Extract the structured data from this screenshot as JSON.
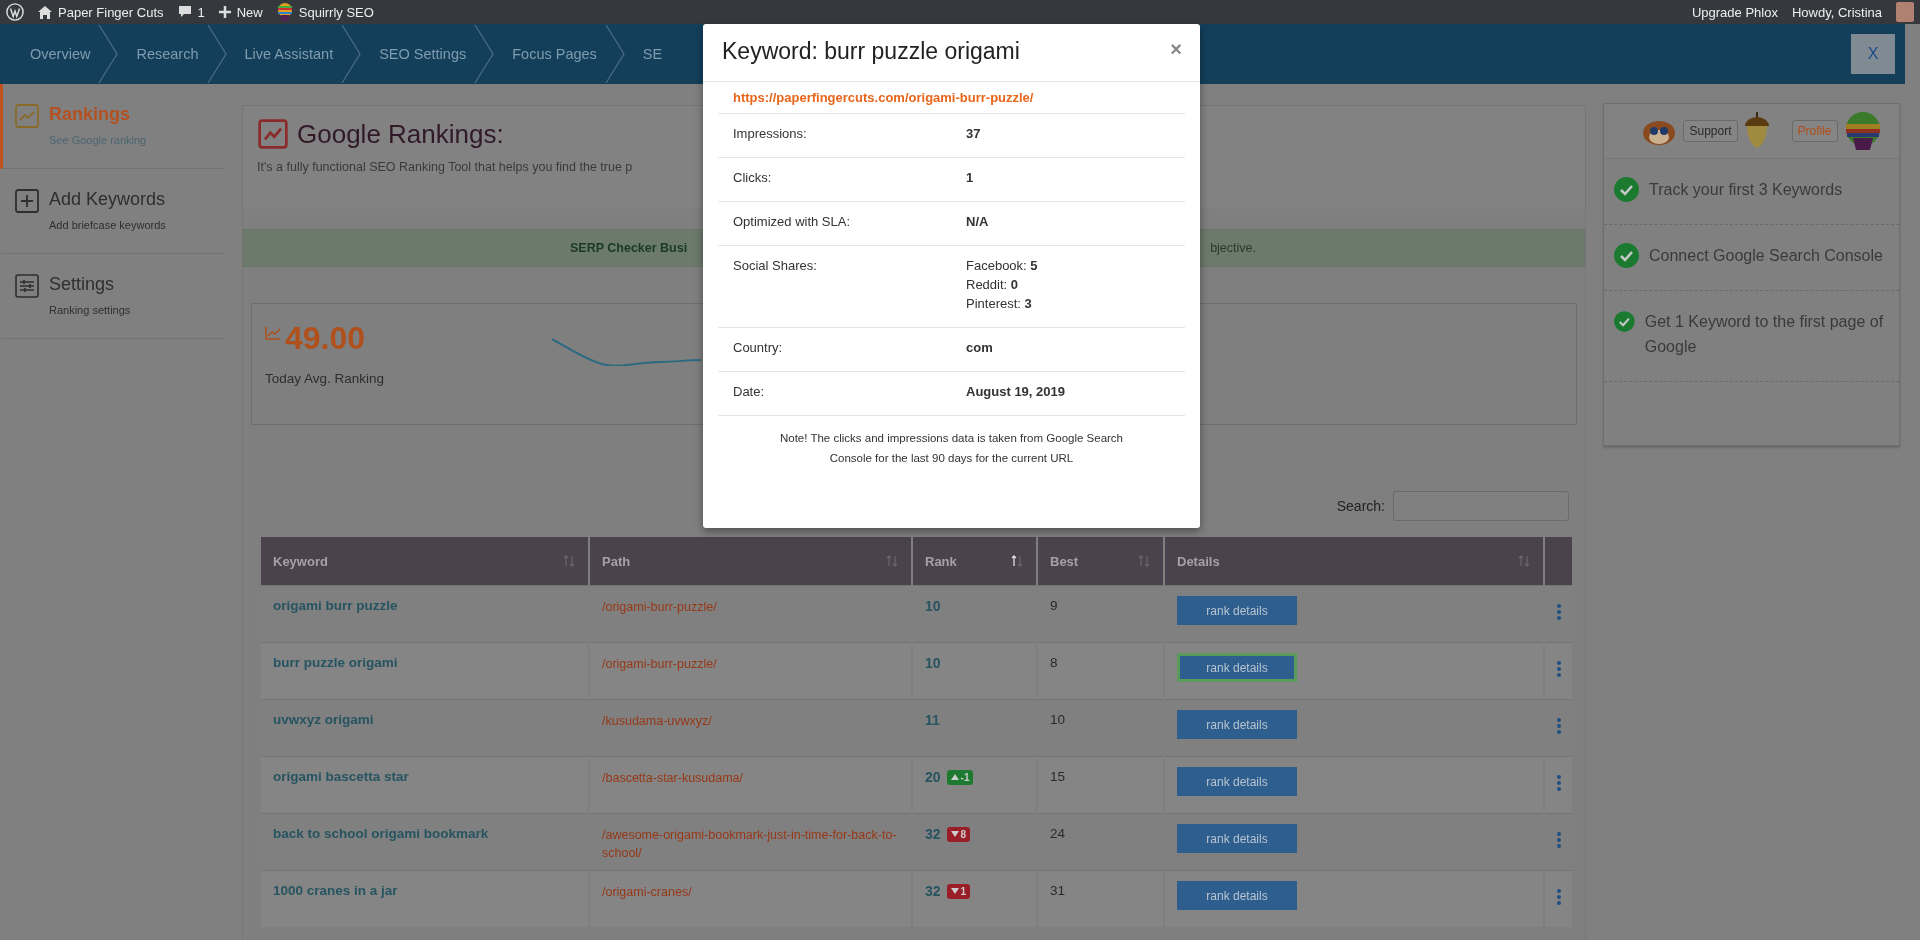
{
  "admin_bar": {
    "site": "Paper Finger Cuts",
    "comments": "1",
    "new": "New",
    "plugin": "Squirrly SEO",
    "upgrade": "Upgrade Phlox",
    "greeting": "Howdy, Cristina"
  },
  "nav": {
    "items": [
      "Overview",
      "Research",
      "Live Assistant",
      "SEO Settings",
      "Focus Pages",
      "SE"
    ],
    "close": "X"
  },
  "sidebar": {
    "items": [
      {
        "kind": "chart",
        "title": "Rankings",
        "subtitle": "See Google ranking",
        "selected": true
      },
      {
        "kind": "plus",
        "title": "Add Keywords",
        "subtitle": "Add briefcase keywords",
        "selected": false
      },
      {
        "kind": "settings",
        "title": "Settings",
        "subtitle": "Ranking settings",
        "selected": false
      }
    ]
  },
  "header": {
    "title": "Google Rankings:",
    "subtitle": "It's a fully functional SEO Ranking Tool that helps you find the true p"
  },
  "alert": {
    "left": "SERP Checker Busi",
    "right": "bjective."
  },
  "stats": {
    "value": "49.00",
    "label": "Today Avg. Ranking"
  },
  "search": {
    "label": "Search:"
  },
  "table": {
    "columns": [
      {
        "label": "Keyword",
        "sorted": false
      },
      {
        "label": "Path",
        "sorted": false
      },
      {
        "label": "Rank",
        "sorted": true
      },
      {
        "label": "Best",
        "sorted": false
      },
      {
        "label": "Details",
        "sorted": false
      }
    ],
    "rows": [
      {
        "keyword": "origami burr puzzle",
        "path": "/origami-burr-puzzle/",
        "rank": "10",
        "best": "9",
        "button": "rank details",
        "focused": false
      },
      {
        "keyword": "burr puzzle origami",
        "path": "/origami-burr-puzzle/",
        "rank": "10",
        "best": "8",
        "button": "rank details",
        "focused": true
      },
      {
        "keyword": "uvwxyz origami",
        "path": "/kusudama-uvwxyz/",
        "rank": "11",
        "best": "10",
        "button": "rank details",
        "focused": false
      },
      {
        "keyword": "origami bascetta star",
        "path": "/bascetta-star-kusudama/",
        "rank": "20",
        "change": {
          "kind": "up",
          "value": "-1"
        },
        "best": "15",
        "button": "rank details",
        "focused": false
      },
      {
        "keyword": "back to school origami bookmark",
        "path": "/awesome-origami-bookmark-just-in-time-for-back-to-school/",
        "rank": "32",
        "change": {
          "kind": "down",
          "value": "8"
        },
        "best": "24",
        "button": "rank details",
        "focused": false
      },
      {
        "keyword": "1000 cranes in a jar",
        "path": "/origami-cranes/",
        "rank": "32",
        "change": {
          "kind": "down",
          "value": "1"
        },
        "best": "31",
        "button": "rank details",
        "focused": false
      }
    ]
  },
  "side_panel": {
    "support": "Support",
    "profile": "Profile",
    "tasks": [
      {
        "text": "Track your first 3 Keywords",
        "done": true
      },
      {
        "text": "Connect Google Search Console",
        "done": true
      },
      {
        "text": "Get 1 Keyword to the first page of Google",
        "done": true
      }
    ]
  },
  "modal": {
    "title": "Keyword: burr puzzle origami",
    "close": "×",
    "url": "https://paperfingercuts.com/origami-burr-puzzle/",
    "rows": [
      {
        "label": "Impressions:",
        "values": [
          "**37**"
        ]
      },
      {
        "label": "Clicks:",
        "values": [
          "**1**"
        ]
      },
      {
        "label": "Optimized with SLA:",
        "values": [
          "**N/A**"
        ]
      },
      {
        "label": "Social Shares:",
        "values": [
          "Facebook: **5**",
          "Reddit: **0**",
          "Pinterest: **3**"
        ]
      },
      {
        "label": "Country:",
        "values": [
          "**com**"
        ]
      },
      {
        "label": "Date:",
        "values": [
          "**August 19, 2019**"
        ]
      }
    ],
    "note": "Note! The clicks and impressions data is taken from Google Search Console for the last 90 days for the current URL"
  }
}
